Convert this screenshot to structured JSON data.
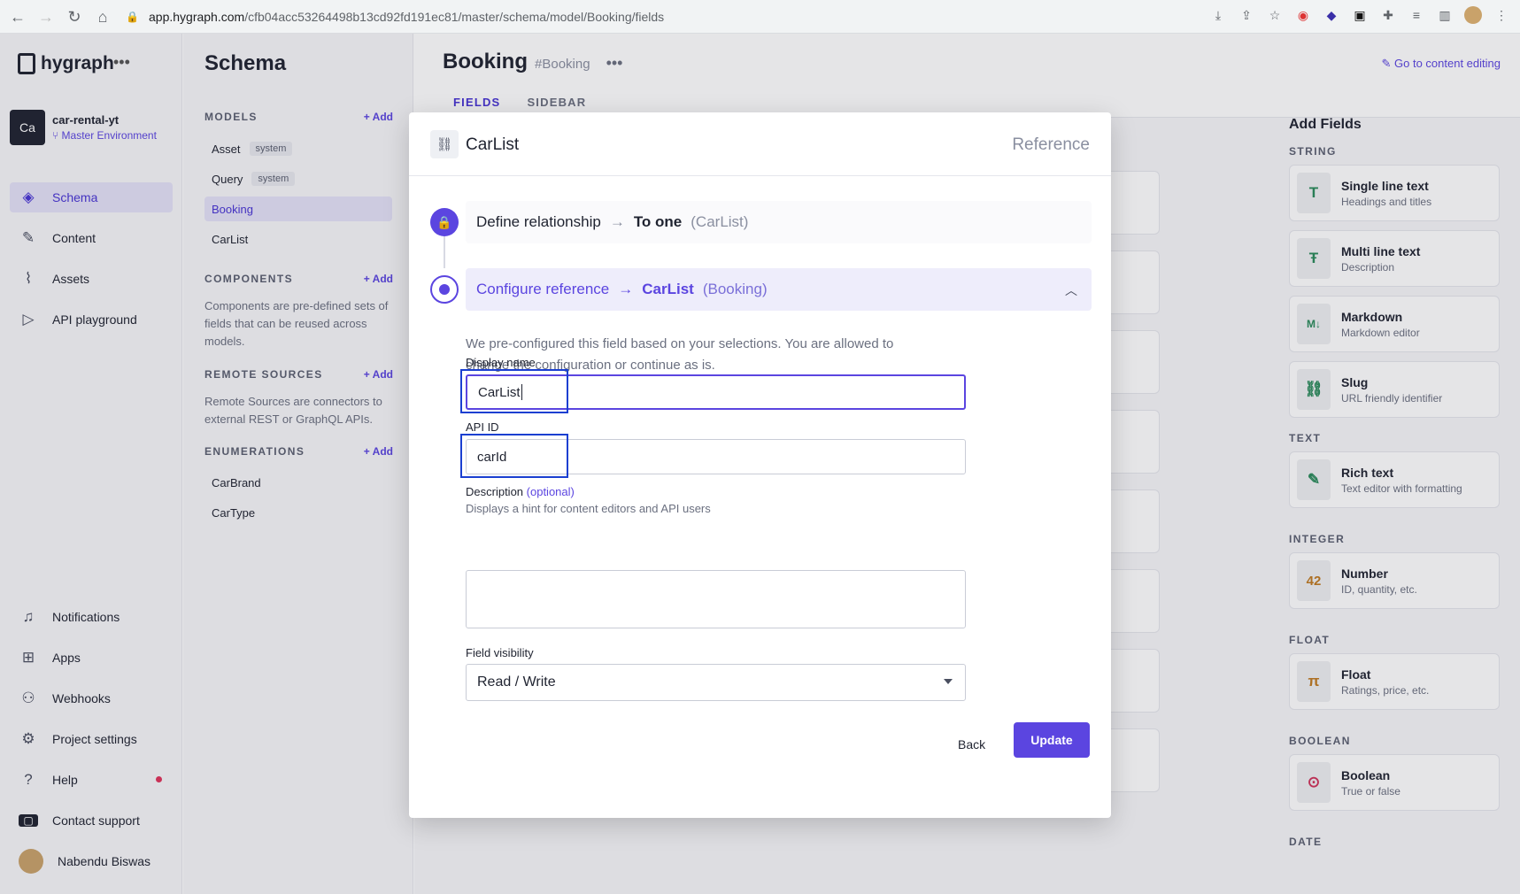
{
  "browser": {
    "url_host": "app.hygraph.com",
    "url_path": "/cfb04acc53264498b13cd92fd191ec81/master/schema/model/Booking/fields"
  },
  "nav": {
    "brand": "hygraph",
    "project": {
      "initials": "Ca",
      "name": "car-rental-yt",
      "env": "Master Environment"
    },
    "items": [
      {
        "label": "Schema",
        "icon": "layers-icon"
      },
      {
        "label": "Content",
        "icon": "edit-icon"
      },
      {
        "label": "Assets",
        "icon": "paperclip-icon"
      },
      {
        "label": "API playground",
        "icon": "play-icon"
      }
    ],
    "bottom_items": [
      {
        "label": "Notifications",
        "icon": "bell-icon"
      },
      {
        "label": "Apps",
        "icon": "apps-icon"
      },
      {
        "label": "Webhooks",
        "icon": "webhooks-icon"
      },
      {
        "label": "Project settings",
        "icon": "gear-icon"
      },
      {
        "label": "Help",
        "icon": "help-icon"
      },
      {
        "label": "Contact support",
        "icon": "chat-icon"
      },
      {
        "label": "Nabendu Biswas",
        "icon": "avatar"
      }
    ]
  },
  "schema": {
    "title": "Schema",
    "models_label": "MODELS",
    "add_label": "Add",
    "models": [
      {
        "name": "Asset",
        "tag": "system"
      },
      {
        "name": "Query",
        "tag": "system"
      },
      {
        "name": "Booking",
        "tag": ""
      },
      {
        "name": "CarList",
        "tag": ""
      }
    ],
    "components_label": "COMPONENTS",
    "components_desc": "Components are pre-defined sets of fields that can be reused across models.",
    "remote_label": "REMOTE SOURCES",
    "remote_desc": "Remote Sources are connectors to external REST or GraphQL APIs.",
    "enum_label": "ENUMERATIONS",
    "enums": [
      "CarBrand",
      "CarType"
    ]
  },
  "main": {
    "model_name": "Booking",
    "model_hash": "#Booking",
    "tabs": [
      "FIELDS",
      "SIDEBAR"
    ],
    "go_content": "Go to content editing"
  },
  "add_fields": {
    "title": "Add Fields",
    "sections": [
      {
        "label": "STRING",
        "items": [
          {
            "name": "Single line text",
            "sub": "Headings and titles",
            "glyph": "T"
          },
          {
            "name": "Multi line text",
            "sub": "Description",
            "glyph": "Ŧ"
          },
          {
            "name": "Markdown",
            "sub": "Markdown editor",
            "glyph": "M↓"
          },
          {
            "name": "Slug",
            "sub": "URL friendly identifier",
            "glyph": "⛓"
          }
        ]
      },
      {
        "label": "TEXT",
        "items": [
          {
            "name": "Rich text",
            "sub": "Text editor with formatting",
            "glyph": "✎"
          }
        ]
      },
      {
        "label": "INTEGER",
        "items": [
          {
            "name": "Number",
            "sub": "ID, quantity, etc.",
            "glyph": "42"
          }
        ]
      },
      {
        "label": "FLOAT",
        "items": [
          {
            "name": "Float",
            "sub": "Ratings, price, etc.",
            "glyph": "π"
          }
        ]
      },
      {
        "label": "BOOLEAN",
        "items": [
          {
            "name": "Boolean",
            "sub": "True or false",
            "glyph": "⊙"
          }
        ]
      },
      {
        "label": "DATE",
        "items": []
      }
    ]
  },
  "modal": {
    "title": "CarList",
    "type": "Reference",
    "step1": {
      "label": "Define relationship",
      "arrow": "→",
      "strong": "To one",
      "paren": "(CarList)"
    },
    "step2": {
      "label": "Configure reference",
      "arrow": "→",
      "strong": "CarList",
      "paren": "(Booking)"
    },
    "intro": "We pre-configured this field based on your selections. You are allowed to change the configuration or continue as is.",
    "display_name_label": "Display name",
    "display_name_value": "CarList",
    "api_id_label": "API ID",
    "api_id_value": "carId",
    "description_label": "Description",
    "description_optional": "(optional)",
    "description_hint": "Displays a hint for content editors and API users",
    "visibility_label": "Field visibility",
    "visibility_value": "Read / Write",
    "back_label": "Back",
    "update_label": "Update"
  },
  "colors": {
    "accent": "#5b45e0",
    "highlight": "#1a3fd1"
  }
}
